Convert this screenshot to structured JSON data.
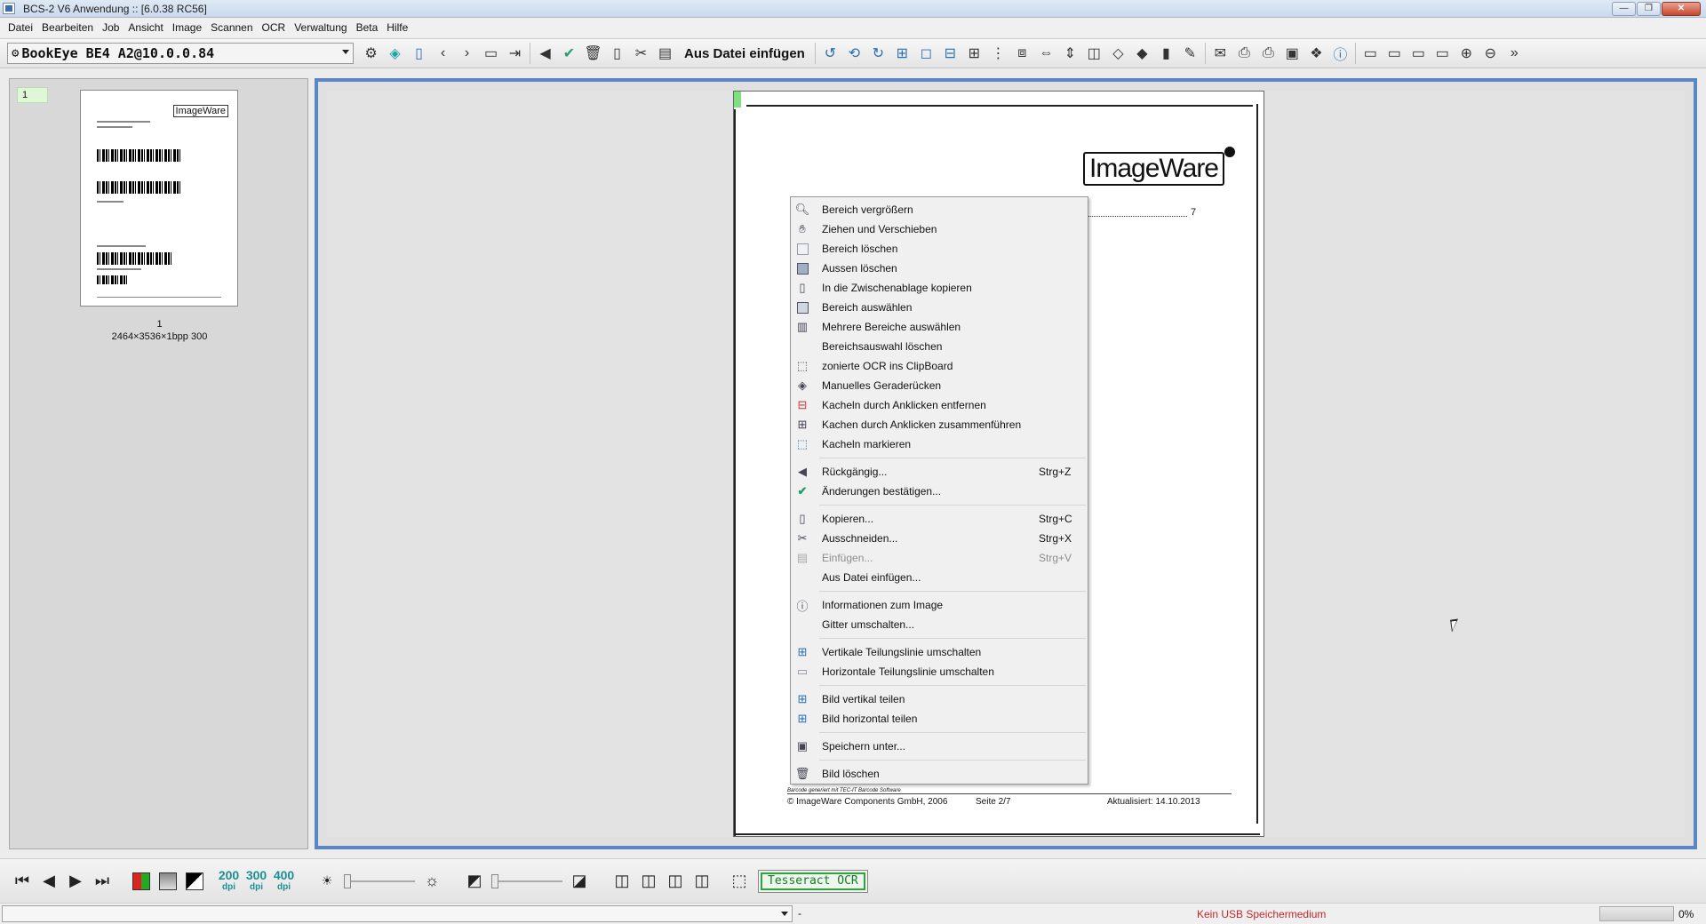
{
  "window": {
    "title": "BCS-2 V6 Anwendung :: [6.0.38 RC56]",
    "minimize": "—",
    "maximize": "❐",
    "close": "✕"
  },
  "menu": [
    "Datei",
    "Bearbeiten",
    "Job",
    "Ansicht",
    "Image",
    "Scannen",
    "OCR",
    "Verwaltung",
    "Beta",
    "Hilfe"
  ],
  "toolbar": {
    "device": "BookEye BE4 A2@10.0.0.84",
    "insert_from_file": "Aus Datei einfügen"
  },
  "thumbnails": {
    "badge": "1",
    "page_number": "1",
    "info": "2464×3536×1bpp 300",
    "logo": "ImageWare"
  },
  "document": {
    "logo": "ImageWare",
    "toc_number": "7",
    "footer_generated": "Barcode generiert mit TEC-IT Barcode Software",
    "footer_copyright": "© ImageWare Components GmbH, 2006",
    "footer_page": "Seite 2/7",
    "footer_date": "Aktualisiert: 14.10.2013"
  },
  "context_menu": {
    "items": [
      {
        "label": "Bereich vergrößern",
        "icon": "magnifier-icon"
      },
      {
        "label": "Ziehen und Verschieben",
        "icon": "hand-icon"
      },
      {
        "label": "Bereich löschen",
        "icon": "clear-area-icon"
      },
      {
        "label": "Aussen löschen",
        "icon": "clear-outside-icon"
      },
      {
        "label": "In die Zwischenablage kopieren",
        "icon": "clipboard-icon"
      },
      {
        "label": "Bereich auswählen",
        "icon": "select-area-icon"
      },
      {
        "label": "Mehrere Bereiche auswählen",
        "icon": "multi-select-icon"
      },
      {
        "label": "Bereichsauswahl löschen",
        "icon": ""
      },
      {
        "label": "zonierte OCR ins ClipBoard",
        "icon": "zonal-ocr-icon"
      },
      {
        "label": "Manuelles Geraderücken",
        "icon": "deskew-icon"
      },
      {
        "label": "Kacheln durch Anklicken entfernen",
        "icon": "tile-remove-icon"
      },
      {
        "label": "Kachen durch Anklicken zusammenführen",
        "icon": "tile-merge-icon"
      },
      {
        "label": "Kacheln markieren",
        "icon": "tile-mark-icon"
      }
    ],
    "undo": {
      "label": "Rückgängig...",
      "shortcut": "Strg+Z"
    },
    "confirm": {
      "label": "Änderungen bestätigen..."
    },
    "copy": {
      "label": "Kopieren...",
      "shortcut": "Strg+C"
    },
    "cut": {
      "label": "Ausschneiden...",
      "shortcut": "Strg+X"
    },
    "paste": {
      "label": "Einfügen...",
      "shortcut": "Strg+V"
    },
    "insert_file": {
      "label": "Aus Datei einfügen..."
    },
    "info": {
      "label": "Informationen zum Image"
    },
    "grid": {
      "label": "Gitter umschalten..."
    },
    "vsplitline": {
      "label": "Vertikale Teilungslinie umschalten"
    },
    "hsplitline": {
      "label": "Horizontale Teilungslinie umschalten"
    },
    "split_v": {
      "label": "Bild vertikal teilen"
    },
    "split_h": {
      "label": "Bild horizontal teilen"
    },
    "save_as": {
      "label": "Speichern unter..."
    },
    "delete": {
      "label": "Bild löschen"
    }
  },
  "bottom": {
    "dpi": [
      {
        "num": "200",
        "unit": "dpi"
      },
      {
        "num": "300",
        "unit": "dpi"
      },
      {
        "num": "400",
        "unit": "dpi"
      }
    ],
    "ocr_engine": "Tesseract OCR"
  },
  "status": {
    "dash": "-",
    "usb": "Kein USB Speichermedium",
    "progress_percent": "0%"
  }
}
